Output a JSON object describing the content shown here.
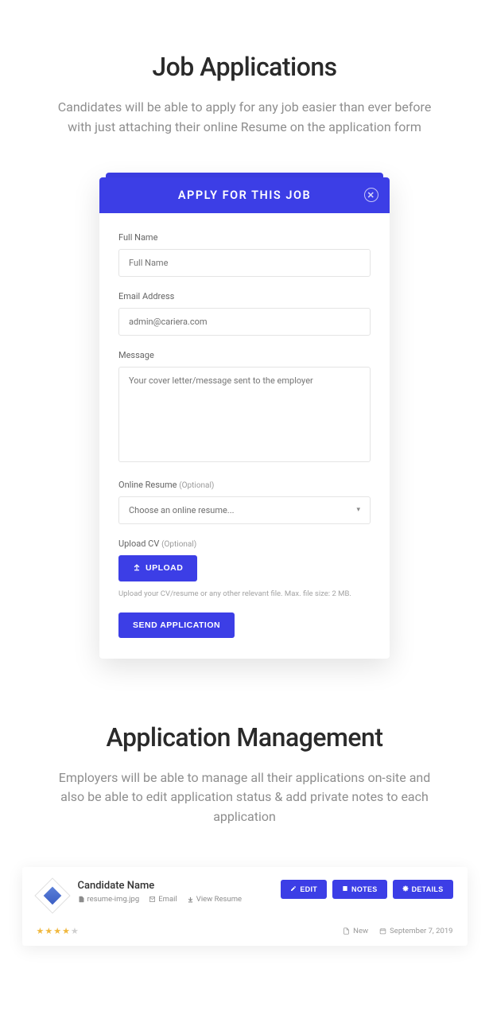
{
  "section1": {
    "title": "Job Applications",
    "desc": "Candidates will be able to apply for any job easier than ever before with just attaching their online Resume on the application form"
  },
  "form": {
    "header": "APPLY FOR THIS JOB",
    "fullname_label": "Full Name",
    "fullname_placeholder": "Full Name",
    "email_label": "Email Address",
    "email_value": "admin@cariera.com",
    "message_label": "Message",
    "message_placeholder": "Your cover letter/message sent to the employer",
    "resume_label": "Online Resume",
    "resume_opt": "(Optional)",
    "resume_select": "Choose an online resume...",
    "upload_label": "Upload CV",
    "upload_opt": "(Optional)",
    "upload_btn": "UPLOAD",
    "upload_hint": "Upload your CV/resume or any other relevant file. Max. file size: 2 MB.",
    "submit_btn": "SEND APPLICATION"
  },
  "section2": {
    "title": "Application Management",
    "desc": "Employers will be able to manage all their applications on-site and also be able to edit application status & add private notes to each application"
  },
  "row": {
    "name": "Candidate Name",
    "meta_file": "resume-img.jpg",
    "meta_email": "Email",
    "meta_view": "View Resume",
    "btn_edit": "EDIT",
    "btn_notes": "NOTES",
    "btn_details": "DETAILS",
    "status": "New",
    "date": "September 7, 2019"
  }
}
